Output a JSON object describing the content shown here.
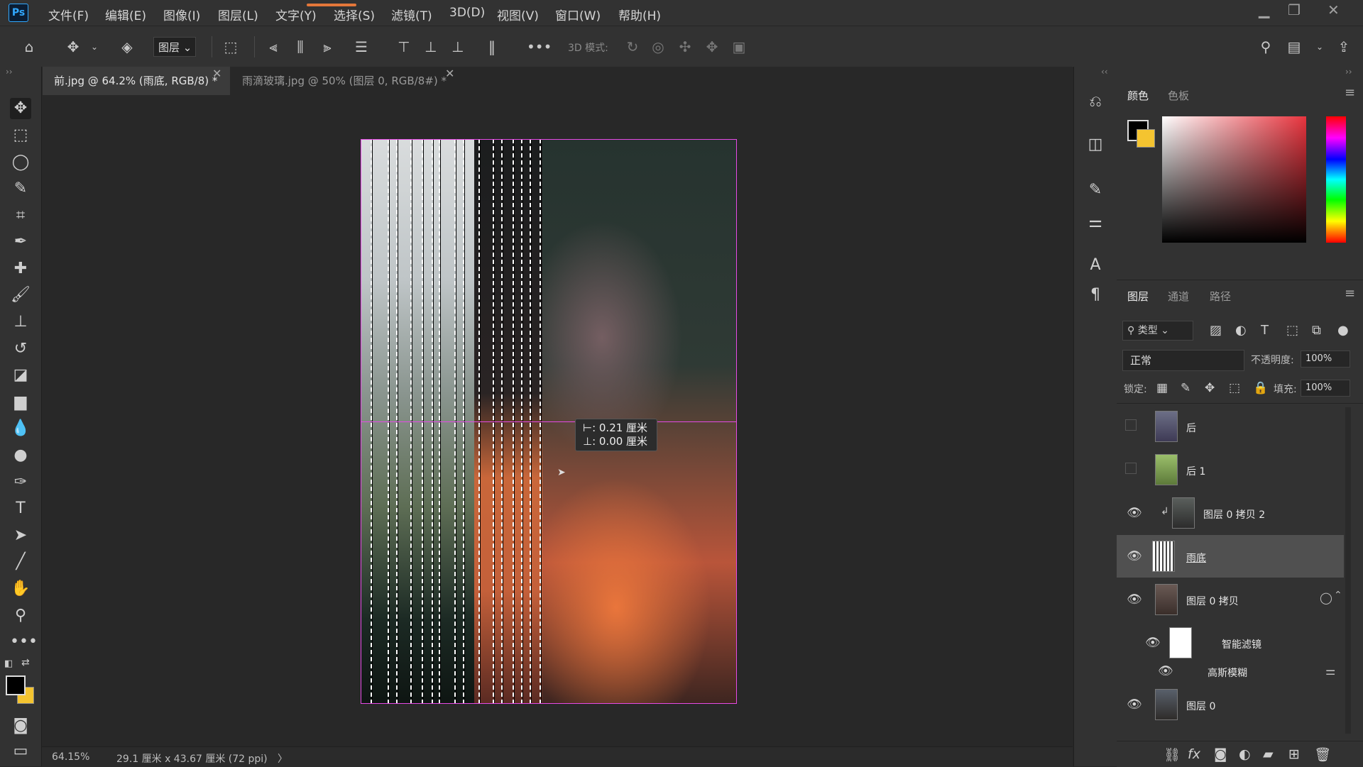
{
  "app": {
    "logo": "Ps"
  },
  "menu": [
    "文件(F)",
    "编辑(E)",
    "图像(I)",
    "图层(L)",
    "文字(Y)",
    "选择(S)",
    "滤镜(T)",
    "3D(D)",
    "视图(V)",
    "窗口(W)",
    "帮助(H)"
  ],
  "options_bar": {
    "layer_select": "图层",
    "mode3d_label": "3D 模式:",
    "more": "•••"
  },
  "tabs": [
    {
      "label": "前.jpg @ 64.2% (雨底, RGB/8) *"
    },
    {
      "label": "雨滴玻璃.jpg @ 50% (图层 0, RGB/8#) *"
    }
  ],
  "measure": {
    "dx": "⊢: 0.21 厘米",
    "dy": "⊥: 0.00 厘米"
  },
  "status": {
    "zoom": "64.15%",
    "doc_info": "29.1 厘米 x 43.67 厘米 (72 ppi)",
    "arrow": "〉"
  },
  "color_panel": {
    "tabs": [
      "颜色",
      "色板"
    ],
    "foreground": "#000000",
    "background": "#f4c430"
  },
  "layers_panel": {
    "tabs": [
      "图层",
      "通道",
      "路径"
    ],
    "filter_label": "类型",
    "blend_mode": "正常",
    "opacity_label": "不透明度:",
    "opacity_value": "100%",
    "lock_label": "锁定:",
    "fill_label": "填充:",
    "fill_value": "100%",
    "layers": [
      {
        "name": "后",
        "visible": false
      },
      {
        "name": "后 1",
        "visible": false
      },
      {
        "name": "图层 0 拷贝 2",
        "visible": true
      },
      {
        "name": "雨底",
        "visible": true,
        "selected": true
      },
      {
        "name": "图层 0 拷贝",
        "visible": true
      },
      {
        "name": "智能滤镜",
        "visible": true
      },
      {
        "name": "高斯模糊",
        "visible": true
      },
      {
        "name": "图层 0",
        "visible": true
      }
    ]
  }
}
